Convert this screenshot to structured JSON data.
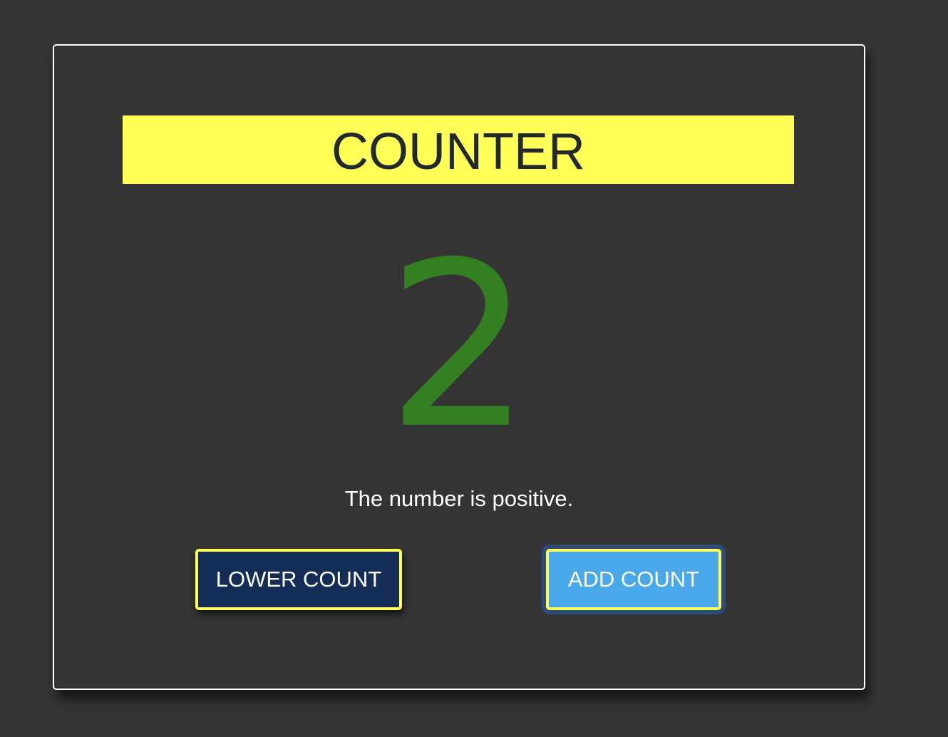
{
  "app": {
    "title": "COUNTER"
  },
  "counter": {
    "value": "2",
    "status": "The number is positive."
  },
  "buttons": {
    "lower_label": "LOWER COUNT",
    "add_label": "ADD COUNT"
  },
  "colors": {
    "background": "#343434",
    "title_bar": "#ffff57",
    "title_text": "#23282d",
    "count_positive": "#347f22",
    "lower_button": "#142d56",
    "add_button": "#48a8ea",
    "button_border": "#ffff57"
  }
}
